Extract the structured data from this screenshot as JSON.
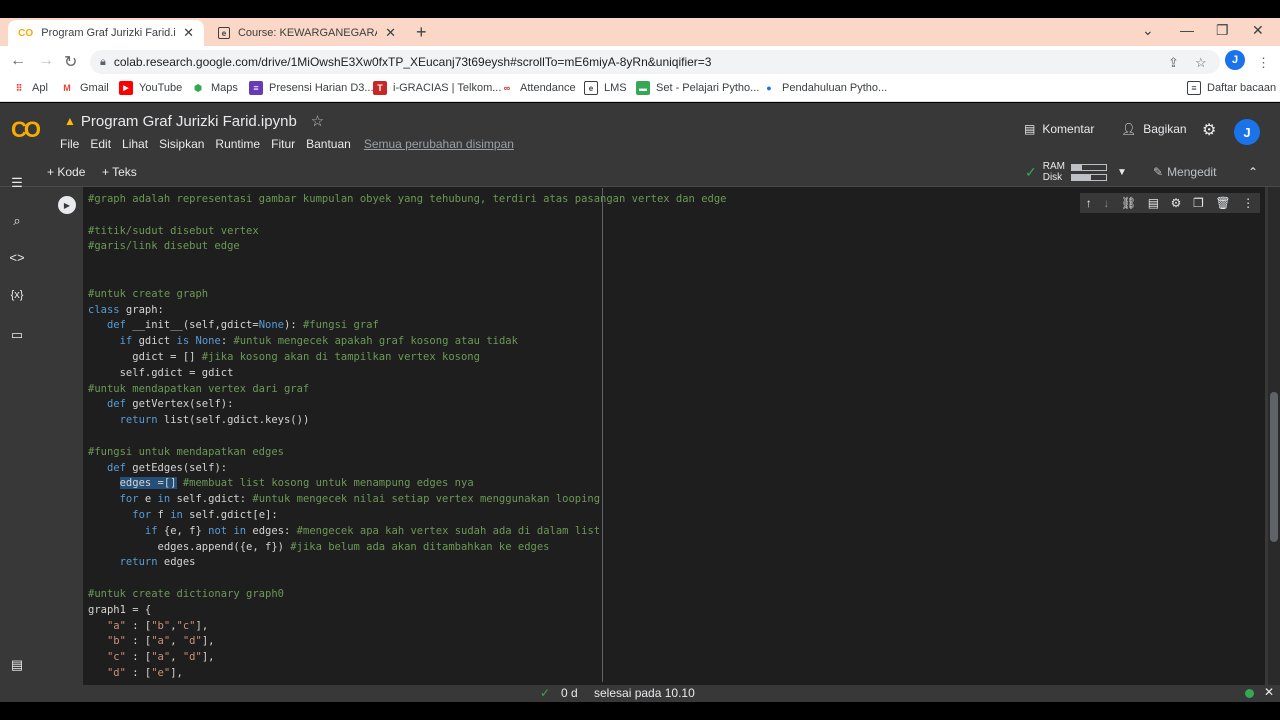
{
  "browser": {
    "tabs": [
      {
        "title": "Program Graf Jurizki Farid.ipynb",
        "icon": "colab-icon"
      },
      {
        "title": "Course: KEWARGANEGARAAN D",
        "icon": "course-icon"
      }
    ],
    "url": "colab.research.google.com/drive/1MiOwshE3Xw0fxTP_XEucanj73t69eysh#scrollTo=mE6miyA-8yRn&uniqifier=3",
    "profile_initial": "J",
    "bookmarks": [
      "Apl",
      "Gmail",
      "YouTube",
      "Maps",
      "Presensi Harian D3...",
      "i-GRACIAS | Telkom...",
      "Attendance",
      "LMS",
      "Set - Pelajari Pytho...",
      "Pendahuluan Pytho..."
    ],
    "reading_list": "Daftar bacaan"
  },
  "colab": {
    "logo": "CO",
    "notebook_title": "Program Graf Jurizki Farid.ipynb",
    "menu": [
      "File",
      "Edit",
      "Lihat",
      "Sisipkan",
      "Runtime",
      "Fitur",
      "Bantuan"
    ],
    "saved_status": "Semua perubahan disimpan",
    "comment_label": "Komentar",
    "share_label": "Bagikan",
    "avatar_initial": "J",
    "add_code": "+ Kode",
    "add_text": "+ Teks",
    "ram_label": "RAM",
    "disk_label": "Disk",
    "ram_usage": 0.3,
    "disk_usage": 0.55,
    "editing_label": "Mengedit"
  },
  "code_lines": [
    "#graph adalah representasi gambar kumpulan obyek yang tehubung, terdiri atas pasangan vertex dan edge",
    "",
    "#titik/sudut disebut vertex",
    "#garis/link disebut edge",
    "",
    "",
    "#untuk create graph",
    "class graph:",
    "   def __init__(self,gdict=None): #fungsi graf",
    "     if gdict is None: #untuk mengecek apakah graf kosong atau tidak",
    "       gdict = [] #jika kosong akan di tampilkan vertex kosong",
    "     self.gdict = gdict",
    "#untuk mendapatkan vertex dari graf",
    "   def getVertex(self):",
    "     return list(self.gdict.keys())",
    "",
    "#fungsi untuk mendapatkan edges",
    "   def getEdges(self):",
    "     edges =[] #membuat list kosong untuk menampung edges nya",
    "     for e in self.gdict: #untuk mengecek nilai setiap vertex menggunakan looping",
    "       for f in self.gdict[e]:",
    "         if {e, f} not in edges: #mengecek apa kah vertex sudah ada di dalam list",
    "           edges.append({e, f}) #jika belum ada akan ditambahkan ke edges",
    "     return edges",
    "",
    "#untuk create dictionary graph0",
    "graph1 = {",
    "   \"a\" : [\"b\",\"c\"],",
    "   \"b\" : [\"a\", \"d\"],",
    "   \"c\" : [\"a\", \"d\"],",
    "   \"d\" : [\"e\"],"
  ],
  "status": {
    "duration": "0 d",
    "message": "selesai pada 10.10"
  },
  "colors": {
    "accent": "#f9ab00",
    "comment": "#6a9955",
    "keyword": "#569cd6",
    "string": "#ce9178",
    "ok": "#34a853"
  }
}
